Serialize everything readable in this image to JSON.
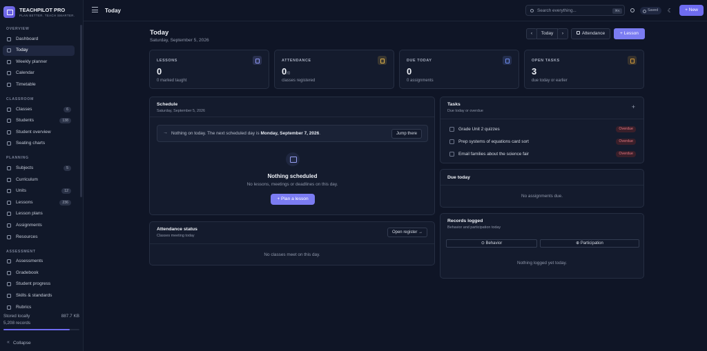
{
  "brand": {
    "title": "TEACHPILOT PRO",
    "tagline": "PLAN BETTER. TEACH SMARTER."
  },
  "sidebar": {
    "sections": [
      {
        "label": "OVERVIEW",
        "items": [
          {
            "label": "Dashboard",
            "icon": "grid-icon"
          },
          {
            "label": "Today",
            "icon": "calendar-day-icon",
            "active": true
          },
          {
            "label": "Weekly planner",
            "icon": "planner-icon"
          },
          {
            "label": "Calendar",
            "icon": "calendar-icon"
          },
          {
            "label": "Timetable",
            "icon": "timetable-icon"
          }
        ]
      },
      {
        "label": "CLASSROOM",
        "items": [
          {
            "label": "Classes",
            "icon": "classes-icon",
            "badge": "6"
          },
          {
            "label": "Students",
            "icon": "students-icon",
            "badge": "138"
          },
          {
            "label": "Student overview",
            "icon": "user-icon"
          },
          {
            "label": "Seating charts",
            "icon": "seating-icon"
          }
        ]
      },
      {
        "label": "PLANNING",
        "items": [
          {
            "label": "Subjects",
            "icon": "book-icon",
            "badge": "5"
          },
          {
            "label": "Curriculum",
            "icon": "curriculum-icon"
          },
          {
            "label": "Units",
            "icon": "units-icon",
            "badge": "12"
          },
          {
            "label": "Lessons",
            "icon": "lessons-icon",
            "badge": "236"
          },
          {
            "label": "Lesson plans",
            "icon": "lesson-plan-icon"
          },
          {
            "label": "Assignments",
            "icon": "assignment-icon"
          },
          {
            "label": "Resources",
            "icon": "folder-icon"
          }
        ]
      },
      {
        "label": "ASSESSMENT",
        "items": [
          {
            "label": "Assessments",
            "icon": "clipboard-icon"
          },
          {
            "label": "Gradebook",
            "icon": "gradebook-icon"
          },
          {
            "label": "Student progress",
            "icon": "chart-icon"
          },
          {
            "label": "Skills & standards",
            "icon": "star-icon"
          },
          {
            "label": "Rubrics",
            "icon": "rubric-icon"
          }
        ]
      }
    ],
    "storage": {
      "label": "Stored locally",
      "size": "887.7 KB",
      "records": "5,208 records",
      "usage": 0.87
    },
    "collapse_label": "Collapse"
  },
  "topbar": {
    "title": "Today",
    "search_placeholder": "Search everything...",
    "search_shortcut": "⌘K",
    "saved_label": "Saved",
    "new_label": "+ New"
  },
  "page": {
    "title": "Today",
    "date": "Saturday, September 5, 2026",
    "buttons": {
      "prev": "‹",
      "today": "Today",
      "next": "›",
      "attendance": "Attendance",
      "lesson": "+ Lesson"
    }
  },
  "stats": [
    {
      "label": "LESSONS",
      "value": "0",
      "suffix": "",
      "note": "0 marked taught",
      "color": "#8e97f5",
      "icon": "lessons-stat-icon"
    },
    {
      "label": "ATTENDANCE",
      "value": "0",
      "suffix": "/0",
      "note": "classes registered",
      "color": "#e0b24a",
      "icon": "attendance-stat-icon"
    },
    {
      "label": "DUE TODAY",
      "value": "0",
      "suffix": "",
      "note": "0 assignments",
      "color": "#6f8df0",
      "icon": "due-stat-icon"
    },
    {
      "label": "OPEN TASKS",
      "value": "3",
      "suffix": "",
      "note": "due today or earlier",
      "color": "#d49a3a",
      "icon": "tasks-stat-icon"
    }
  ],
  "schedule": {
    "title": "Schedule",
    "date": "Saturday, September 5, 2026",
    "notice_prefix": "Nothing on today. The next scheduled day is ",
    "notice_date": "Monday, September 7, 2026",
    "notice_suffix": ".",
    "jump_label": "Jump there",
    "empty_title": "Nothing scheduled",
    "empty_text": "No lessons, meetings or deadlines on this day.",
    "plan_label": "+ Plan a lesson"
  },
  "attendance": {
    "title": "Attendance status",
    "subtitle": "Classes meeting today",
    "button": "Open register →",
    "empty": "No classes meet on this day."
  },
  "tasks": {
    "title": "Tasks",
    "subtitle": "Due today or overdue",
    "add_label": "+",
    "items": [
      {
        "label": "Grade Unit 2 quizzes",
        "badge": "Overdue"
      },
      {
        "label": "Prep systems of equations card sort",
        "badge": "Overdue"
      },
      {
        "label": "Email families about the science fair",
        "badge": "Overdue"
      }
    ]
  },
  "due_today": {
    "title": "Due today",
    "empty": "No assignments due."
  },
  "records": {
    "title": "Records logged",
    "subtitle": "Behavior and participation today",
    "tabs": [
      "⊙ Behavior",
      "⊕ Participation"
    ],
    "empty": "Nothing logged yet today."
  }
}
